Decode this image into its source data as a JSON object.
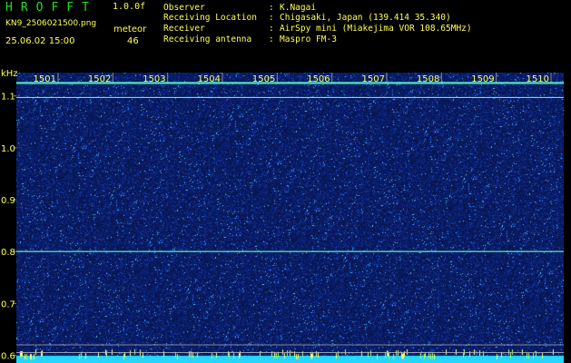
{
  "app": {
    "title": "HROFFT",
    "version": "1.0.0f",
    "file_name": "KN9_2506021500.png",
    "date_time": "25.06.02 15:00",
    "meteor_label": "meteor",
    "meteor_count": "46"
  },
  "info": [
    {
      "label": "Observer",
      "sep": ":",
      "value": "K.Nagai"
    },
    {
      "label": "Receiving Location",
      "sep": ":",
      "value": "Chigasaki, Japan (139.414 35.340)"
    },
    {
      "label": "Receiver",
      "sep": ":",
      "value": "AirSpy mini (Miakejima VOR 108.65MHz)"
    },
    {
      "label": "Receiving antenna",
      "sep": ":",
      "value": "Maspro FM-3"
    }
  ],
  "colors": {
    "background": "#000000",
    "waterfall_base": "#0a1a5a",
    "signal": "#66ffcc",
    "label": "#ffff55",
    "title": "#22dd22",
    "grid": "#888888"
  },
  "chart_data": {
    "type": "heatmap",
    "xlabel": "",
    "ylabel": "kHz",
    "x_ticks": [
      "1501",
      "1502",
      "1503",
      "1504",
      "1505",
      "1506",
      "1507",
      "1508",
      "1509",
      "1510"
    ],
    "y_ticks": [
      1.1,
      1.0,
      0.9,
      0.8,
      0.7,
      0.6
    ],
    "ylim": [
      0.585,
      1.145
    ],
    "signal_lines_khz": [
      {
        "khz": 1.125,
        "intensity": "strong"
      },
      {
        "khz": 1.097,
        "intensity": "medium"
      },
      {
        "khz": 0.8,
        "intensity": "medium"
      },
      {
        "khz": 0.62,
        "intensity": "reference"
      },
      {
        "khz": 0.605,
        "intensity": "reference"
      }
    ],
    "grid": true
  }
}
